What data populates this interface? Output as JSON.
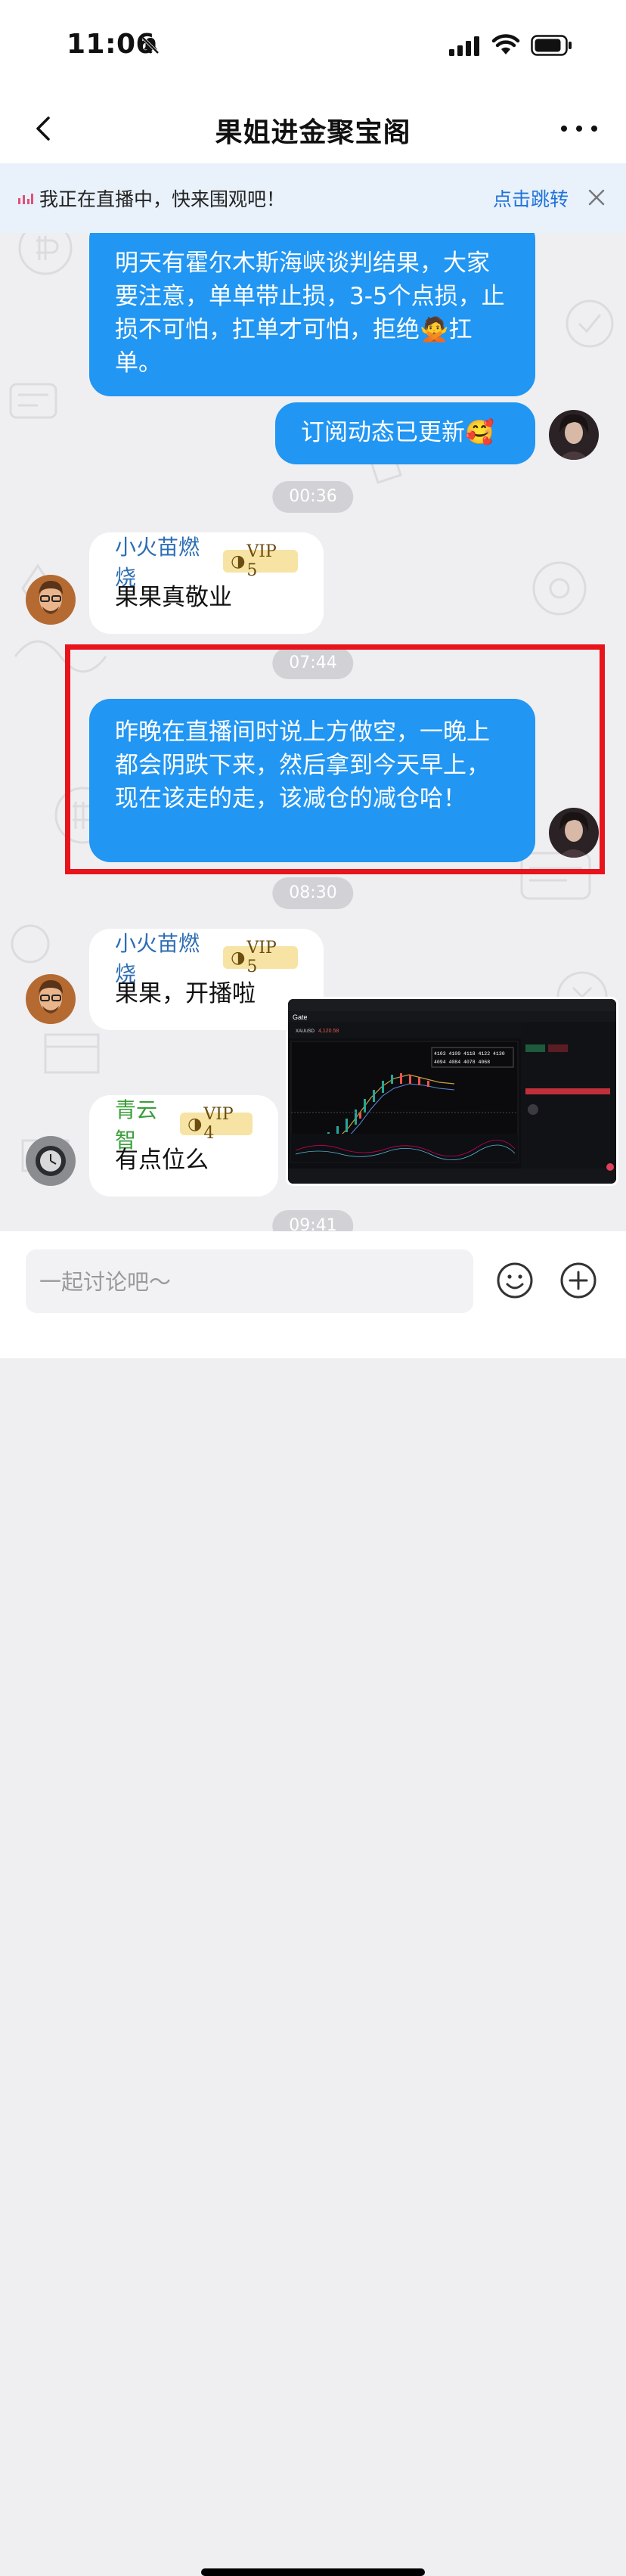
{
  "status_bar": {
    "time": "11:06"
  },
  "header": {
    "title": "果姐进金聚宝阁",
    "back_icon": "chevron-left-icon",
    "more_icon": "ellipsis-icon"
  },
  "live_banner": {
    "text": "我正在直播中，快来围观吧！",
    "link": "点击跳转"
  },
  "messages": {
    "m1": {
      "text": "明天有霍尔木斯海峡谈判结果，大家要注意，单单带止损，3-5个点损，止损不可怕，扛单才可怕，拒绝🙅扛单。"
    },
    "m2": {
      "text": "订阅动态已更新🥰"
    },
    "t1": "00:36",
    "m3": {
      "sender": "小火苗燃烧",
      "vip": "VIP 5",
      "text": "果果真敬业"
    },
    "t2": "07:44",
    "m4": {
      "text": "昨晚在直播间时说上方做空，一晚上都会阴跌下来，然后拿到今天早上，现在该走的走，该减仓的减仓哈！"
    },
    "t3": "08:30",
    "m5": {
      "sender": "小火苗燃烧",
      "vip": "VIP 5",
      "text": "果果，开播啦"
    },
    "m6": {
      "sender": "青云智",
      "vip": "VIP 4",
      "text": "有点位么"
    },
    "t4": "09:41"
  },
  "shared_screenshot": {
    "brand": "Gate",
    "symbol": "XAUUSD",
    "price": "4,120.58",
    "price_levels_row1": "4103  4109  4118  4122  4130",
    "price_levels_row2": "4094  4084  4078  4068"
  },
  "composer": {
    "placeholder": "一起讨论吧～",
    "emoji_icon": "smiley-icon",
    "plus_icon": "plus-circle-icon"
  },
  "colors": {
    "bubble_blue": "#2196f3",
    "link_blue": "#1f73d8",
    "highlight_red": "#e8131b",
    "vip_gold": "#f7e4a4"
  }
}
